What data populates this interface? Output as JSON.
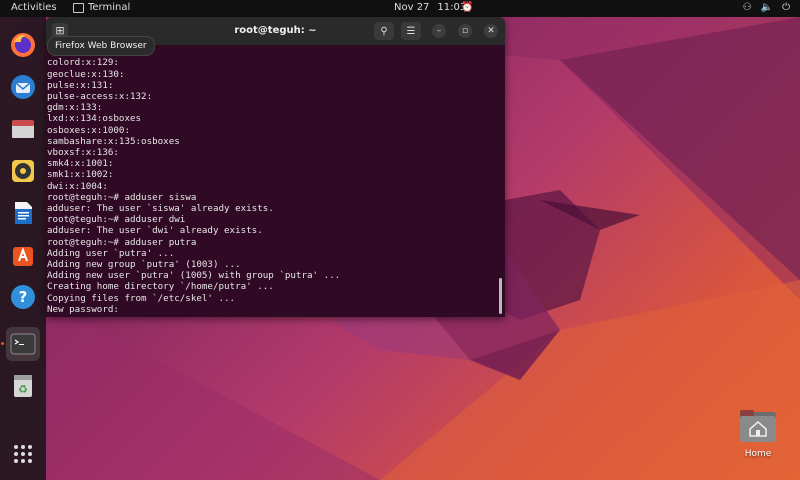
{
  "topbar": {
    "activities": "Activities",
    "app_name": "Terminal",
    "date": "Nov 27",
    "time": "11:03"
  },
  "dock": {
    "tooltip": "Firefox Web Browser",
    "items": [
      {
        "name": "firefox-icon",
        "color": "#ff7139"
      },
      {
        "name": "thunderbird-icon",
        "color": "#2a7fd4"
      },
      {
        "name": "files-icon",
        "color": "#c94b4b"
      },
      {
        "name": "rhythmbox-icon",
        "color": "#f2c94c"
      },
      {
        "name": "writer-icon",
        "color": "#1e6ec8"
      },
      {
        "name": "software-icon",
        "color": "#e95420"
      },
      {
        "name": "help-icon",
        "color": "#2f8fd8"
      },
      {
        "name": "terminal-icon",
        "color": "#333333"
      },
      {
        "name": "trash-icon",
        "color": "#d7d7d7"
      }
    ]
  },
  "terminal": {
    "title": "root@teguh: ~",
    "lines": [
      "colord:x:129:",
      "geoclue:x:130:",
      "pulse:x:131:",
      "pulse-access:x:132:",
      "gdm:x:133:",
      "lxd:x:134:osboxes",
      "osboxes:x:1000:",
      "sambashare:x:135:osboxes",
      "vboxsf:x:136:",
      "smk4:x:1001:",
      "smk1:x:1002:",
      "dwi:x:1004:",
      "root@teguh:~# adduser siswa",
      "adduser: The user `siswa' already exists.",
      "root@teguh:~# adduser dwi",
      "adduser: The user `dwi' already exists.",
      "root@teguh:~# adduser putra",
      "Adding user `putra' ...",
      "Adding new group `putra' (1003) ...",
      "Adding new user `putra' (1005) with group `putra' ...",
      "Creating home directory `/home/putra' ...",
      "Copying files from `/etc/skel' ...",
      "New password:"
    ]
  },
  "desktop": {
    "home_label": "Home"
  }
}
